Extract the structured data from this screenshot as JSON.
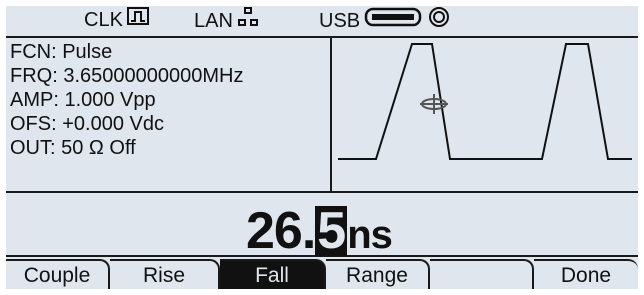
{
  "status": {
    "clk_label": "CLK",
    "lan_label": "LAN",
    "usb_label": "USB"
  },
  "params": {
    "fcn": "FCN: Pulse",
    "frq": "FRQ: 3.65000000000MHz",
    "amp": "AMP: 1.000 Vpp",
    "ofs": "OFS: +0.000 Vdc",
    "out": "OUT: 50 Ω Off"
  },
  "value": {
    "integer_part": "26.",
    "selected_digit": "5",
    "unit": "ns"
  },
  "softkeys": [
    {
      "label": "Couple"
    },
    {
      "label": "Rise"
    },
    {
      "label": "Fall"
    },
    {
      "label": "Range"
    },
    {
      "label": ""
    },
    {
      "label": "Done"
    }
  ],
  "colors": {
    "screen_bg": "#dfe6ee",
    "ink": "#111111"
  }
}
